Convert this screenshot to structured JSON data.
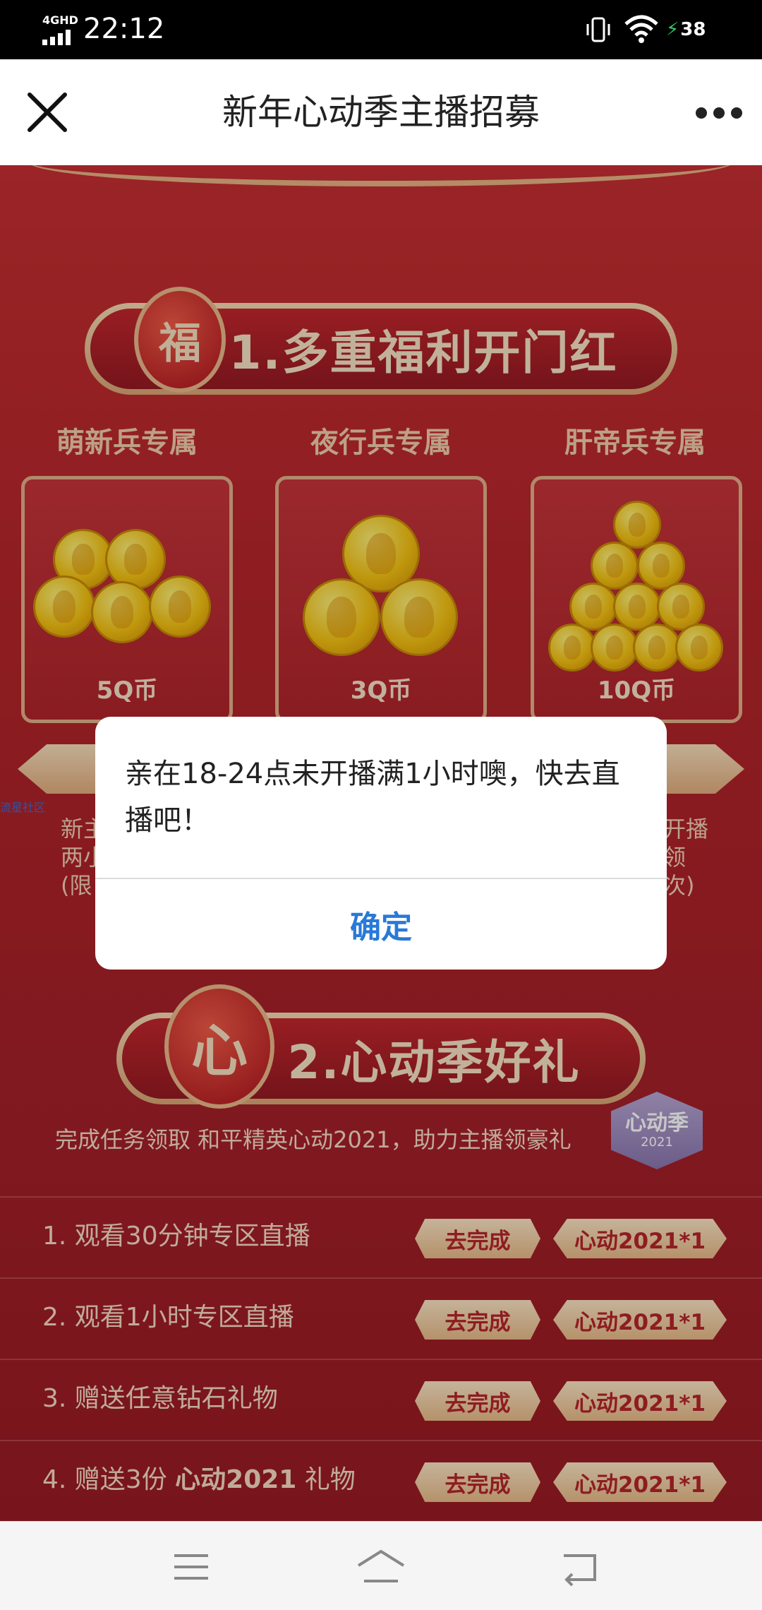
{
  "status_bar": {
    "network": "4GHD",
    "time": "22:12",
    "battery": "38"
  },
  "nav": {
    "title": "新年心动季主播招募"
  },
  "section1": {
    "banner": "1.多重福利开门红",
    "bag_char": "福",
    "tiers": [
      {
        "title": "萌新兵专属",
        "amount": "5Q币"
      },
      {
        "title": "夜行兵专属",
        "amount": "3Q币"
      },
      {
        "title": "肝帝兵专属",
        "amount": "10Q币"
      }
    ],
    "desc_left": "新主\n两小\n(限",
    "desc_right": "开播\n领\n次)",
    "watermark": "流星社区"
  },
  "section2": {
    "banner": "2.心动季好礼",
    "bag_char": "心",
    "subline": "完成任务领取 和平精英心动2021，助力主播领豪礼",
    "badge": {
      "line1": "心动季",
      "line2": "2021"
    },
    "tasks": [
      {
        "label": "1.  观看30分钟专区直播",
        "action": "去完成",
        "reward": "心动2021*1"
      },
      {
        "label": "2.  观看1小时专区直播",
        "action": "去完成",
        "reward": "心动2021*1"
      },
      {
        "label": "3.  赠送任意钻石礼物",
        "action": "去完成",
        "reward": "心动2021*1"
      },
      {
        "label_pre": "4.  赠送3份 ",
        "label_bold": "心动2021",
        "label_post": " 礼物",
        "action": "去完成",
        "reward": "心动2021*1"
      }
    ]
  },
  "dialog": {
    "message": "亲在18-24点未开播满1小时噢，快去直播吧！",
    "confirm": "确定"
  }
}
